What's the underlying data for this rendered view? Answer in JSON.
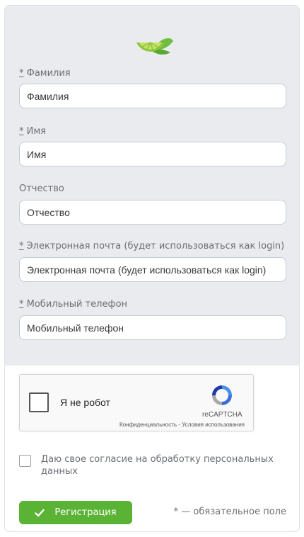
{
  "form": {
    "fields": [
      {
        "required_mark": "*",
        "label": "Фамилия",
        "placeholder": "Фамилия"
      },
      {
        "required_mark": "*",
        "label": "Имя",
        "placeholder": "Имя"
      },
      {
        "required_mark": "",
        "label": "Отчество",
        "placeholder": "Отчество"
      },
      {
        "required_mark": "*",
        "label": "Электронная почта (будет использоваться как login)",
        "placeholder": "Электронная почта (будет использоваться как login)"
      },
      {
        "required_mark": "*",
        "label": "Мобильный телефон",
        "placeholder": "Мобильный телефон"
      }
    ]
  },
  "recaptcha": {
    "label": "Я не робот",
    "brand": "reCAPTCHA",
    "privacy": "Конфиденциальность",
    "separator": " - ",
    "terms": "Условия использования"
  },
  "consent": {
    "text": "Даю свое согласие на обработку персональных данных",
    "checked": false
  },
  "submit": {
    "label": "Регистрация",
    "icon": "check-icon"
  },
  "required_note": "* — обязательное поле",
  "colors": {
    "accent": "#5ab335",
    "background": "#e9ebee"
  }
}
